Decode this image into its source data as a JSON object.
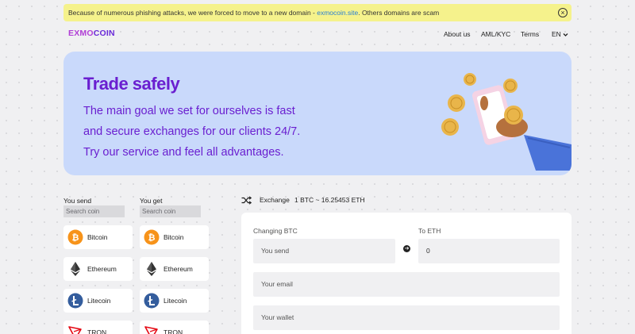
{
  "banner": {
    "text_before": "Because of numerous phishing attacks, we were forced to move to a new domain - ",
    "domain_link": "exmocoin.site",
    "text_after": ". Others domains are scam",
    "close_glyph": "×"
  },
  "logo": {
    "part1": "EXMO",
    "part2": "COIN"
  },
  "nav": {
    "about": "About us",
    "aml": "AML/KYC",
    "terms": "Terms",
    "lang": "EN"
  },
  "hero": {
    "title": "Trade safely",
    "line1": "The main goal we set for ourselves is fast",
    "line2": "and secure exchanges for our clients 24/7.",
    "line3": "Try our service and feel all advantages."
  },
  "send": {
    "label": "You send",
    "search_placeholder": "Search coin",
    "coins": [
      "Bitcoin",
      "Ethereum",
      "Litecoin",
      "TRON"
    ]
  },
  "get": {
    "label": "You get",
    "search_placeholder": "Search coin",
    "coins": [
      "Bitcoin",
      "Ethereum",
      "Litecoin",
      "TRON"
    ]
  },
  "exchange": {
    "label": "Exchange",
    "rate": "1 BTC ~ 16.25453 ETH",
    "changing_label": "Changing BTC",
    "to_label": "To ETH",
    "send_placeholder": "You send",
    "receive_value": "0",
    "email_placeholder": "Your email",
    "wallet_placeholder": "Your wallet"
  },
  "colors": {
    "brand_purple": "#6a1fd0",
    "logo_pink": "#b13fd6",
    "warning_bg": "#f5f28c",
    "link_blue": "#2a7fd4",
    "hero_bg": "#c9d9fb",
    "bitcoin": "#f7931a",
    "litecoin": "#345d9d",
    "tron": "#e50914"
  }
}
